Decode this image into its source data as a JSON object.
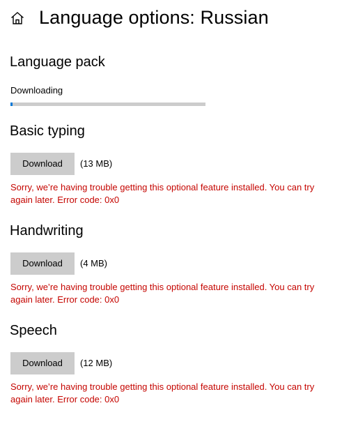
{
  "header": {
    "title": "Language options: Russian",
    "home_icon": "home-icon"
  },
  "language_pack": {
    "title": "Language pack",
    "status": "Downloading",
    "progress_fraction": 0.01
  },
  "features": [
    {
      "title": "Basic typing",
      "button_label": "Download",
      "size": "(13 MB)",
      "error": "Sorry, we’re having trouble getting this optional feature installed. You can try again later. Error code: 0x0"
    },
    {
      "title": "Handwriting",
      "button_label": "Download",
      "size": "(4 MB)",
      "error": "Sorry, we’re having trouble getting this optional feature installed. You can try again later. Error code: 0x0"
    },
    {
      "title": "Speech",
      "button_label": "Download",
      "size": "(12 MB)",
      "error": "Sorry, we’re having trouble getting this optional feature installed. You can try again later. Error code: 0x0"
    }
  ],
  "colors": {
    "error": "#c50500",
    "accent": "#0078d7",
    "button_bg": "#cccccc",
    "track": "#cccccc"
  }
}
